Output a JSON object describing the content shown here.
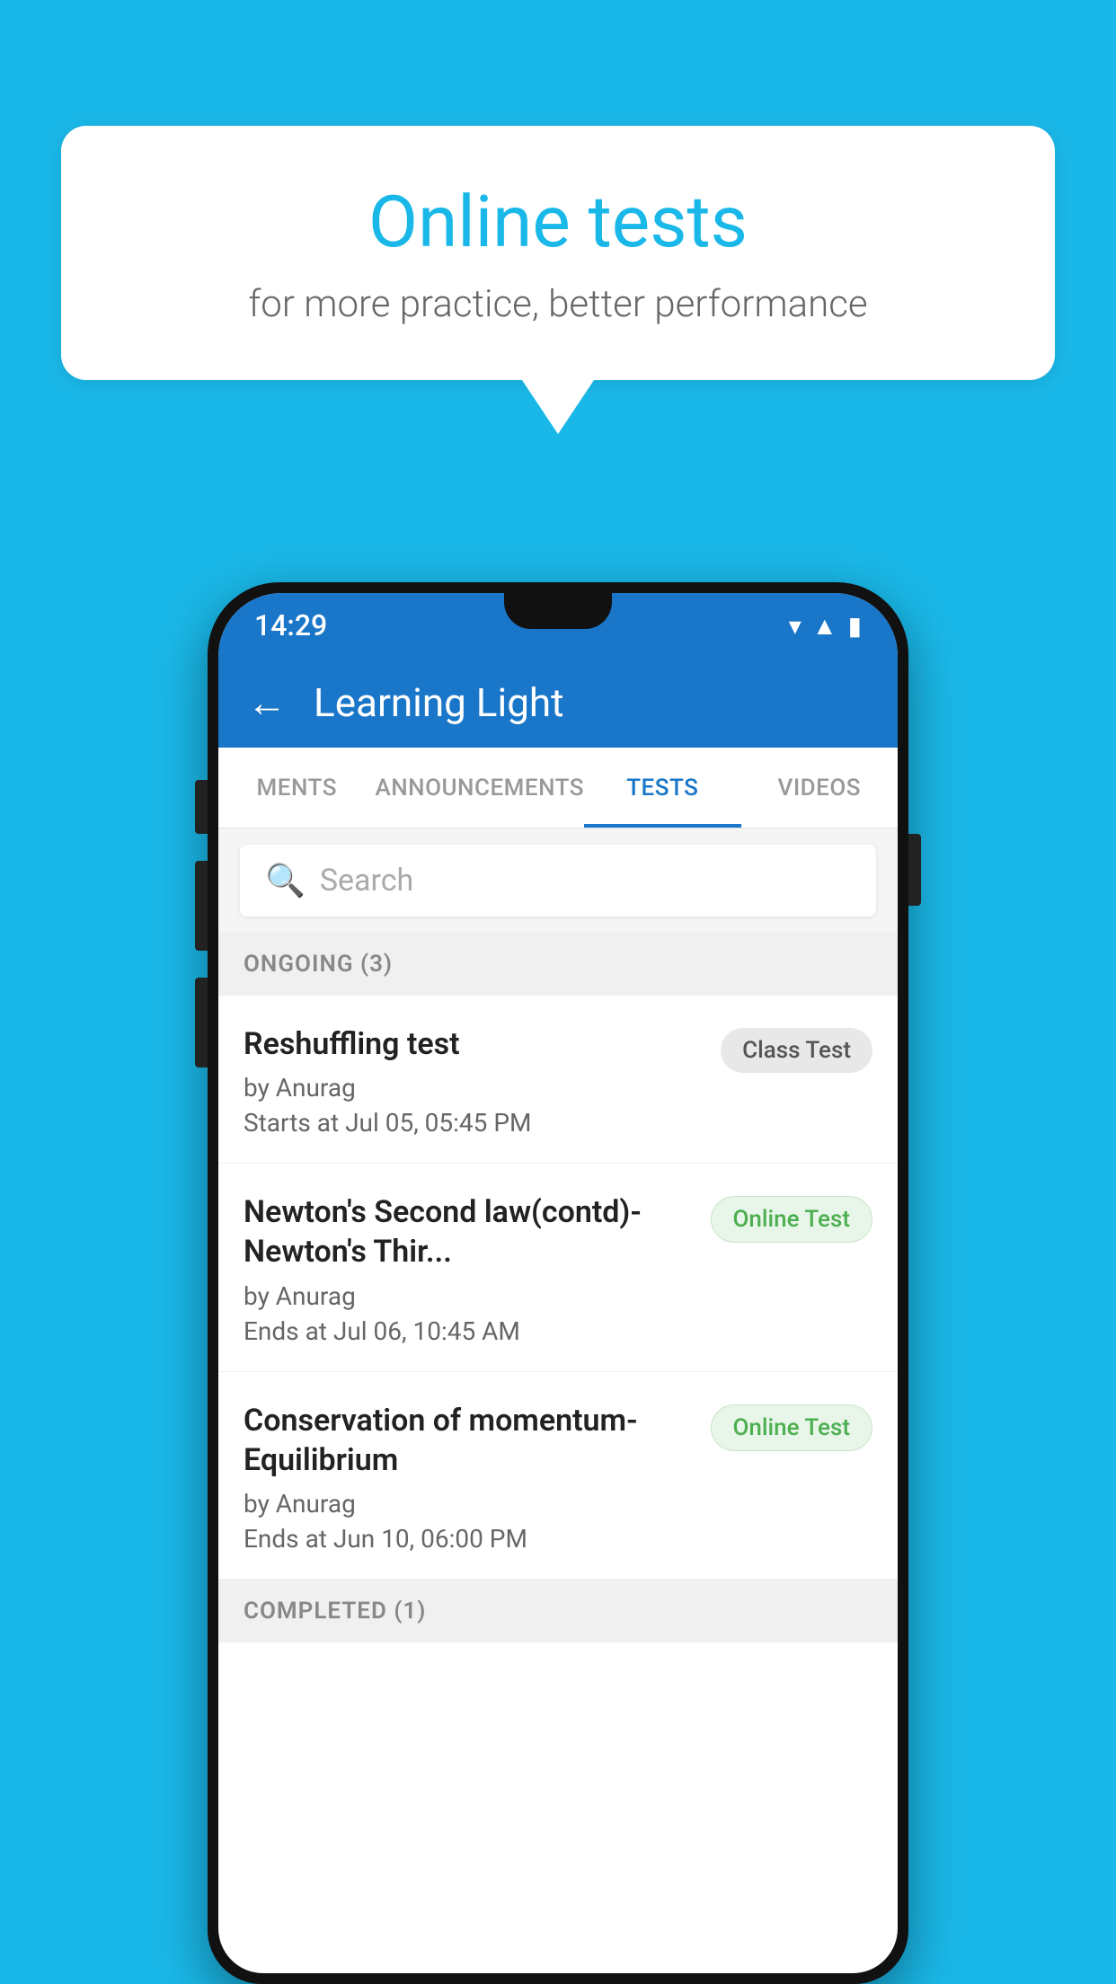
{
  "background_color": "#1ab8e8",
  "speech_bubble": {
    "title": "Online tests",
    "subtitle": "for more practice, better performance"
  },
  "phone": {
    "status_bar": {
      "time": "14:29",
      "icons": [
        "wifi",
        "signal",
        "battery"
      ]
    },
    "app_bar": {
      "back_label": "←",
      "title": "Learning Light"
    },
    "tabs": [
      {
        "label": "MENTS",
        "active": false
      },
      {
        "label": "ANNOUNCEMENTS",
        "active": false
      },
      {
        "label": "TESTS",
        "active": true
      },
      {
        "label": "VIDEOS",
        "active": false
      }
    ],
    "search": {
      "placeholder": "Search"
    },
    "ongoing_section": {
      "label": "ONGOING (3)"
    },
    "tests": [
      {
        "title": "Reshuffling test",
        "by": "by Anurag",
        "date": "Starts at  Jul 05, 05:45 PM",
        "badge": "Class Test",
        "badge_type": "class"
      },
      {
        "title": "Newton's Second law(contd)-Newton's Thir...",
        "by": "by Anurag",
        "date": "Ends at  Jul 06, 10:45 AM",
        "badge": "Online Test",
        "badge_type": "online"
      },
      {
        "title": "Conservation of momentum-Equilibrium",
        "by": "by Anurag",
        "date": "Ends at  Jun 10, 06:00 PM",
        "badge": "Online Test",
        "badge_type": "online"
      }
    ],
    "completed_section": {
      "label": "COMPLETED (1)"
    }
  }
}
